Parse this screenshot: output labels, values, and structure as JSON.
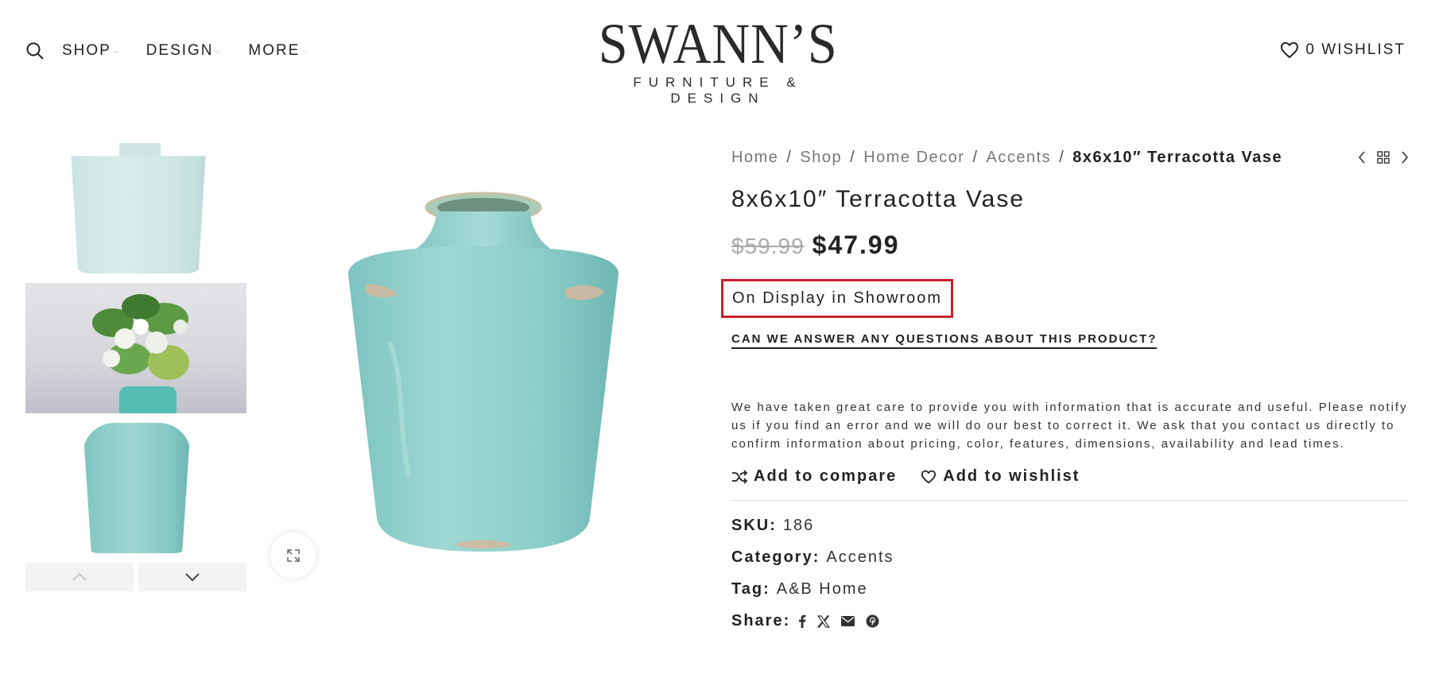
{
  "header": {
    "logo_main": "SWANN’S",
    "logo_sub": "FURNITURE & DESIGN",
    "nav": [
      {
        "label": "SHOP"
      },
      {
        "label": "DESIGN"
      },
      {
        "label": "MORE"
      }
    ],
    "wishlist_label": "0 WISHLIST"
  },
  "breadcrumb": {
    "items": [
      "Home",
      "Shop",
      "Home Decor",
      "Accents"
    ],
    "current": "8x6x10″ Terracotta Vase"
  },
  "product": {
    "title": "8x6x10″ Terracotta Vase",
    "old_price": "$59.99",
    "new_price": "$47.99",
    "availability": "On Display in Showroom",
    "question_link": "CAN WE ANSWER ANY QUESTIONS ABOUT THIS PRODUCT?",
    "disclaimer": "We have taken great care to provide you with information that is accurate and useful. Please notify us if you find an error and we will do our best to correct it. We ask that you contact us directly to confirm information about pricing, color, features, dimensions, availability and lead times.",
    "compare_label": "Add to compare",
    "wishlist_label": "Add to wishlist",
    "sku_label": "SKU:",
    "sku": "186",
    "category_label": "Category:",
    "category": "Accents",
    "tag_label": "Tag:",
    "tag": "A&B Home",
    "share_label": "Share:"
  },
  "share_icons": [
    "facebook-icon",
    "x-icon",
    "email-icon",
    "pinterest-icon"
  ],
  "colors": {
    "highlight_border": "#c8202c",
    "vase": "#8fd0cb",
    "text": "#222222"
  }
}
